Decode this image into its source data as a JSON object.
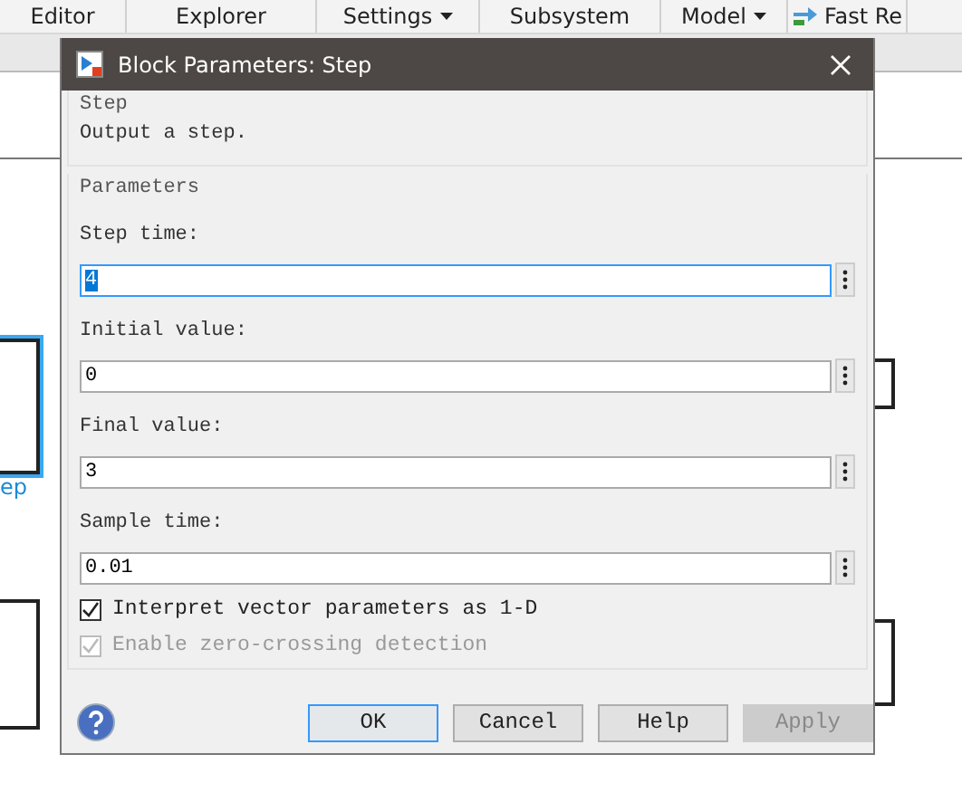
{
  "toolbar": {
    "items": [
      {
        "label": "Editor",
        "caret": false
      },
      {
        "label": "Explorer",
        "caret": false
      },
      {
        "label": "Settings",
        "caret": true
      },
      {
        "label": "Subsystem",
        "caret": false
      },
      {
        "label": "Model",
        "caret": true
      },
      {
        "label": "Fast Re",
        "caret": false,
        "kind": "icon"
      }
    ]
  },
  "canvas": {
    "block_label": "ep"
  },
  "dialog": {
    "title": "Block Parameters: Step",
    "description_group": {
      "legend": "Step",
      "text": "Output a step."
    },
    "parameters_group": {
      "legend": "Parameters",
      "fields": [
        {
          "label": "Step time:",
          "value": "4",
          "focused": true
        },
        {
          "label": "Initial value:",
          "value": "0",
          "focused": false
        },
        {
          "label": "Final value:",
          "value": "3",
          "focused": false
        },
        {
          "label": "Sample time:",
          "value": "0.01",
          "focused": false
        }
      ],
      "checkboxes": [
        {
          "label": "Interpret vector parameters as 1-D",
          "checked": true,
          "disabled": false
        },
        {
          "label": "Enable zero-crossing detection",
          "checked": true,
          "disabled": true
        }
      ]
    },
    "buttons": [
      {
        "label": "OK",
        "default": true,
        "disabled": false
      },
      {
        "label": "Cancel",
        "default": false,
        "disabled": false
      },
      {
        "label": "Help",
        "default": false,
        "disabled": false
      },
      {
        "label": "Apply",
        "default": false,
        "disabled": true
      }
    ]
  }
}
